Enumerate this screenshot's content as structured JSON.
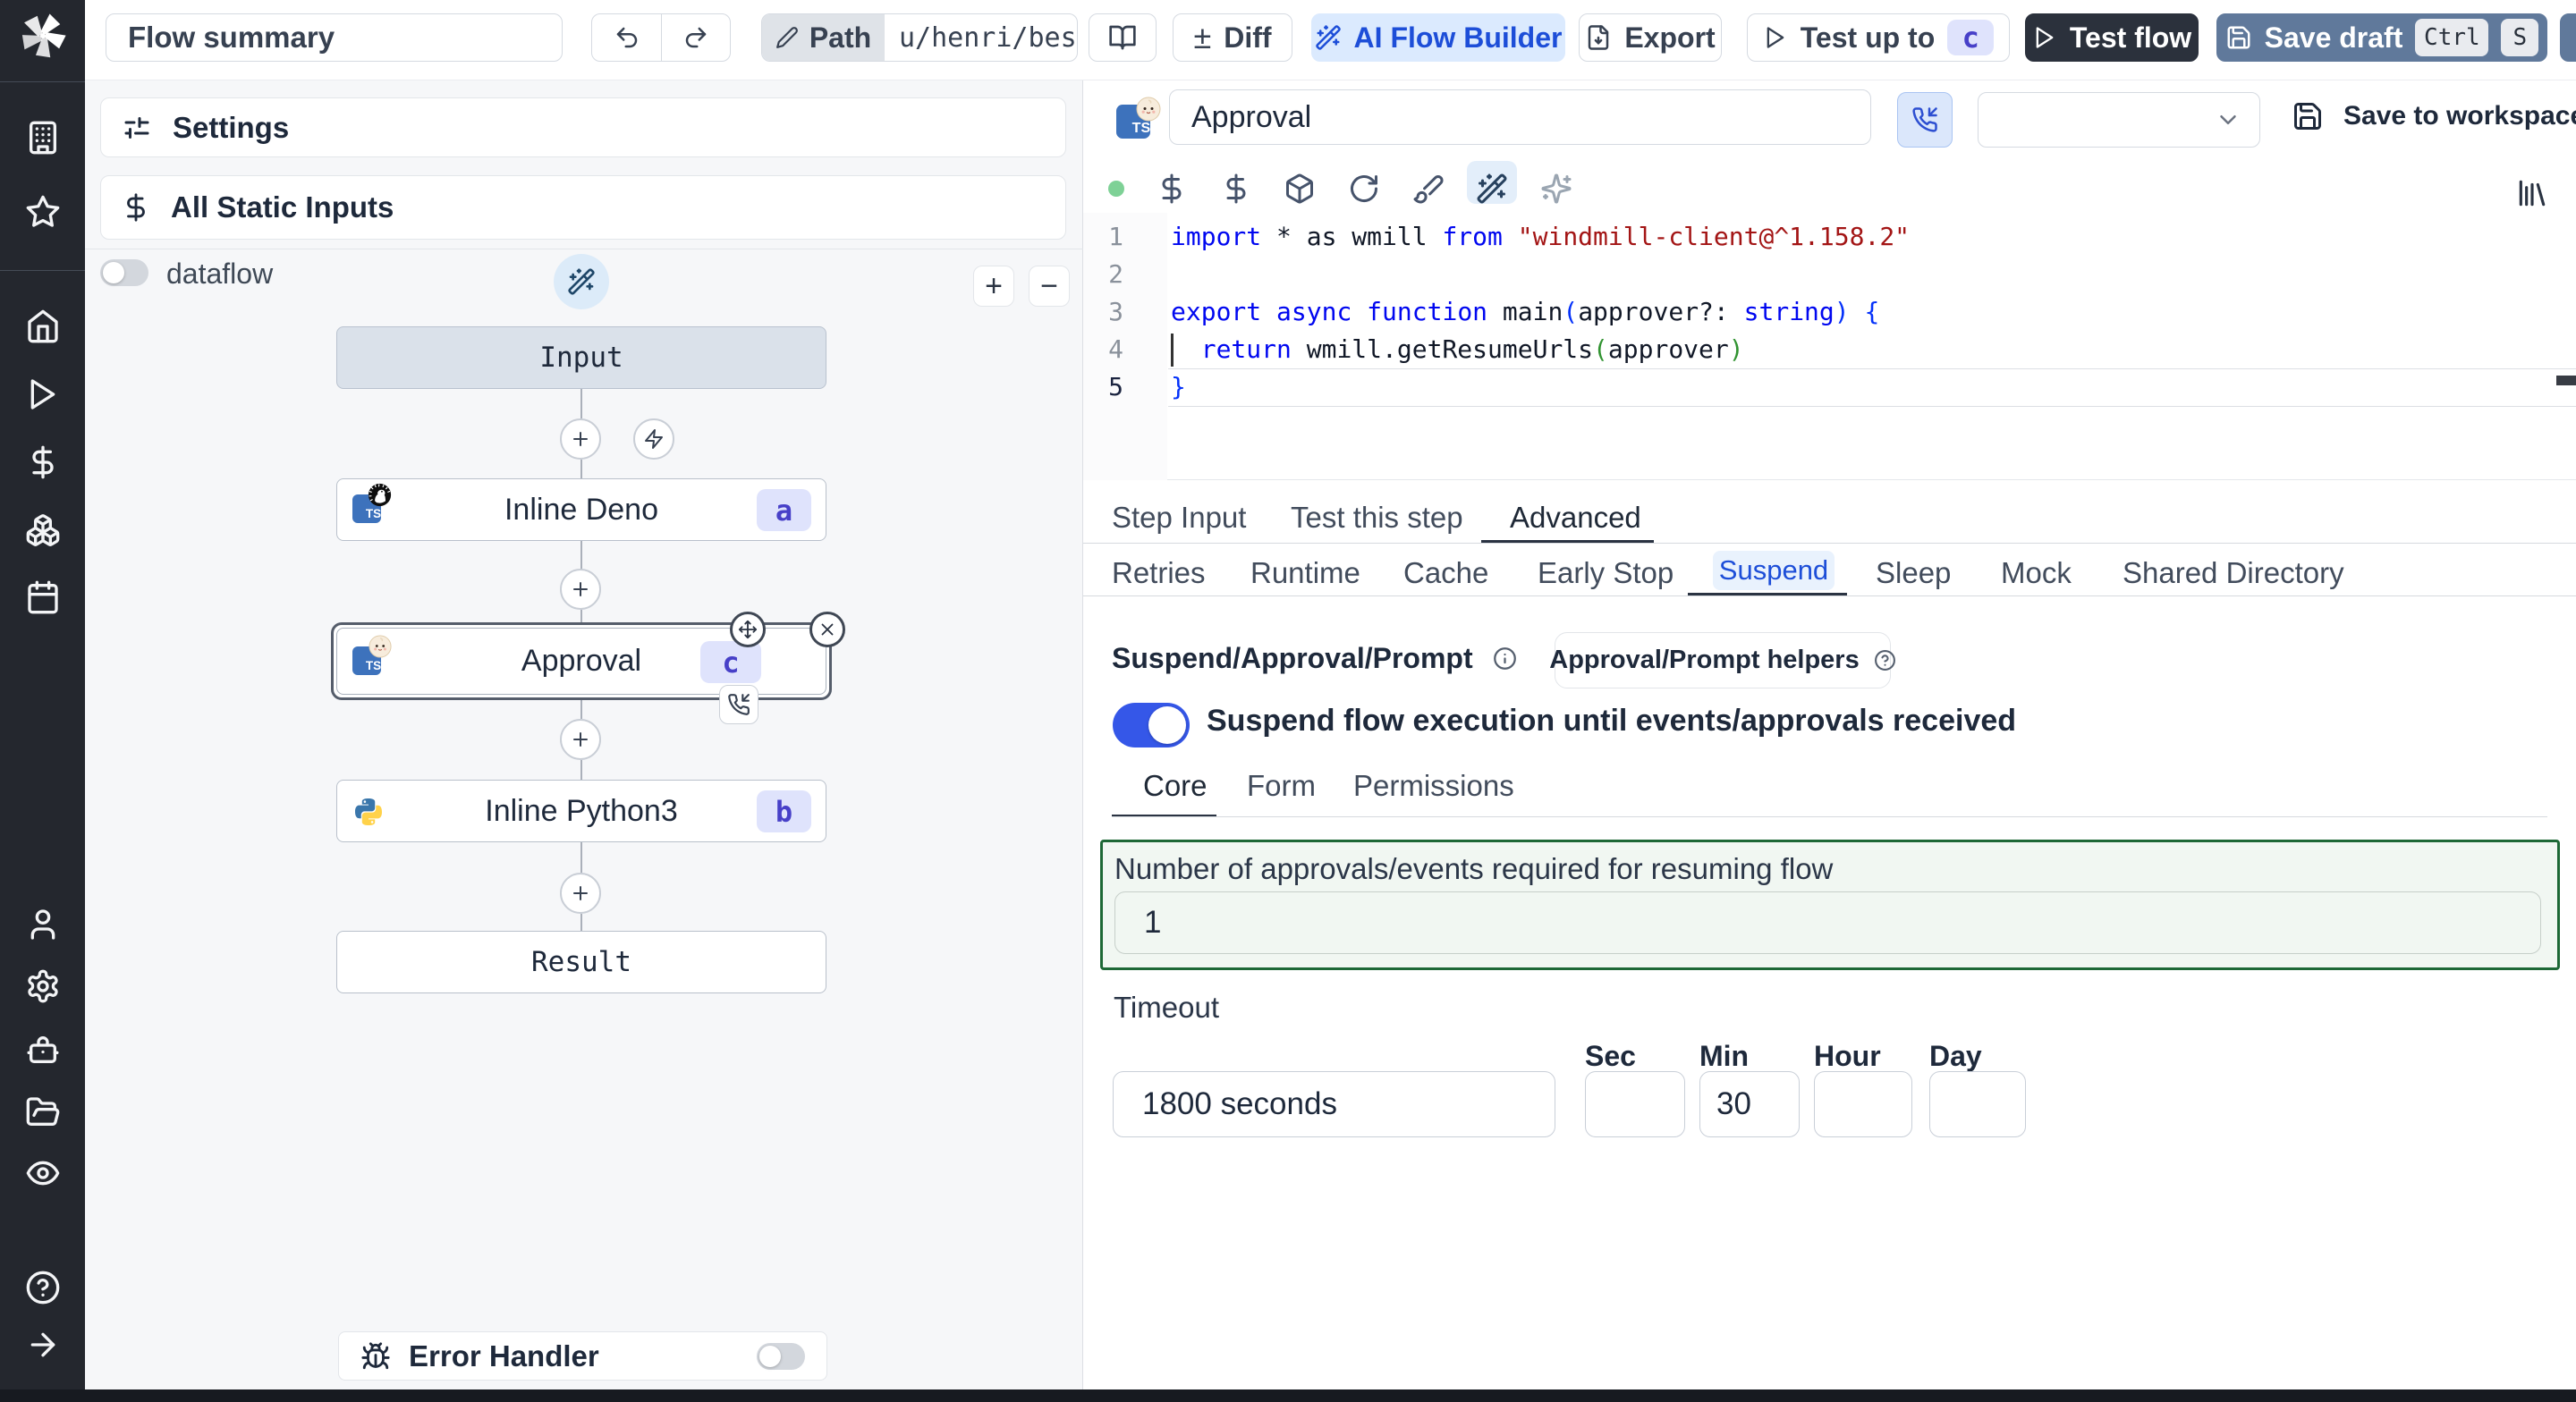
{
  "colors": {
    "accent_blue": "#3557e8",
    "sidebar_bg": "#24272e",
    "save_draft_bg": "#60799b",
    "test_flow_bg": "#2b313c",
    "badge_bg": "#dfe3fc",
    "badge_text": "#4740c8",
    "green_border": "#166534",
    "green_bg": "#f1f7f2",
    "status_dot": "#7ed196"
  },
  "topbar": {
    "flow_summary_value": "Flow summary",
    "path_label": "Path",
    "path_value": "u/henri/bes",
    "diff_sign": "±",
    "diff_label": "Diff",
    "ai_flow_builder_label": "AI Flow Builder",
    "export_label": "Export",
    "test_up_to_label": "Test up to",
    "test_up_to_badge": "c",
    "test_flow_label": "Test flow",
    "save_draft_label": "Save draft",
    "kbd_ctrl": "Ctrl",
    "kbd_s": "S"
  },
  "flow_panel": {
    "settings_label": "Settings",
    "static_inputs_label": "All Static Inputs",
    "dataflow_label": "dataflow",
    "error_handler_label": "Error Handler",
    "zoom_in": "+",
    "zoom_out": "−",
    "graph": {
      "input_label": "Input",
      "deno_label": "Inline Deno",
      "deno_badge": "a",
      "approval_label": "Approval",
      "approval_badge": "c",
      "python_label": "Inline Python3",
      "python_badge": "b",
      "result_label": "Result"
    }
  },
  "step_editor": {
    "ts_label": "TS",
    "step_name_value": "Approval",
    "save_to_workspace_label": "Save to workspace",
    "code_lines": [
      [
        [
          "k",
          "import"
        ],
        [
          "p",
          " * as wmill "
        ],
        [
          "k",
          "from"
        ],
        [
          "p",
          " "
        ],
        [
          "s",
          "\"windmill-client@^1.158.2\""
        ]
      ],
      [],
      [
        [
          "k",
          "export"
        ],
        [
          "p",
          " "
        ],
        [
          "k",
          "async"
        ],
        [
          "p",
          " "
        ],
        [
          "k",
          "function"
        ],
        [
          "p",
          " main"
        ],
        [
          "b1",
          "("
        ],
        [
          "p",
          "approver?: "
        ],
        [
          "k",
          "string"
        ],
        [
          "b1",
          ")"
        ],
        [
          "p",
          " "
        ],
        [
          "b1",
          "{"
        ]
      ],
      [
        [
          "p",
          "  "
        ],
        [
          "k",
          "return"
        ],
        [
          "p",
          " wmill.getResumeUrls"
        ],
        [
          "b2",
          "("
        ],
        [
          "p",
          "approver"
        ],
        [
          "b2",
          ")"
        ]
      ],
      [
        [
          "b1",
          "}"
        ]
      ]
    ]
  },
  "tabs": {
    "main": [
      "Step Input",
      "Test this step",
      "Advanced"
    ],
    "sub": [
      "Retries",
      "Runtime",
      "Cache",
      "Early Stop",
      "Suspend",
      "Sleep",
      "Mock",
      "Shared Directory"
    ],
    "core": [
      "Core",
      "Form",
      "Permissions"
    ]
  },
  "suspend": {
    "section_title": "Suspend/Approval/Prompt",
    "helpers_button_label": "Approval/Prompt helpers",
    "toggle_label": "Suspend flow execution until events/approvals received",
    "approvals_label": "Number of approvals/events required for resuming flow",
    "approvals_value": "1",
    "timeout_label": "Timeout",
    "timeout_value": "1800 seconds",
    "sec_label": "Sec",
    "min_label": "Min",
    "hour_label": "Hour",
    "day_label": "Day",
    "min_value": "30"
  }
}
